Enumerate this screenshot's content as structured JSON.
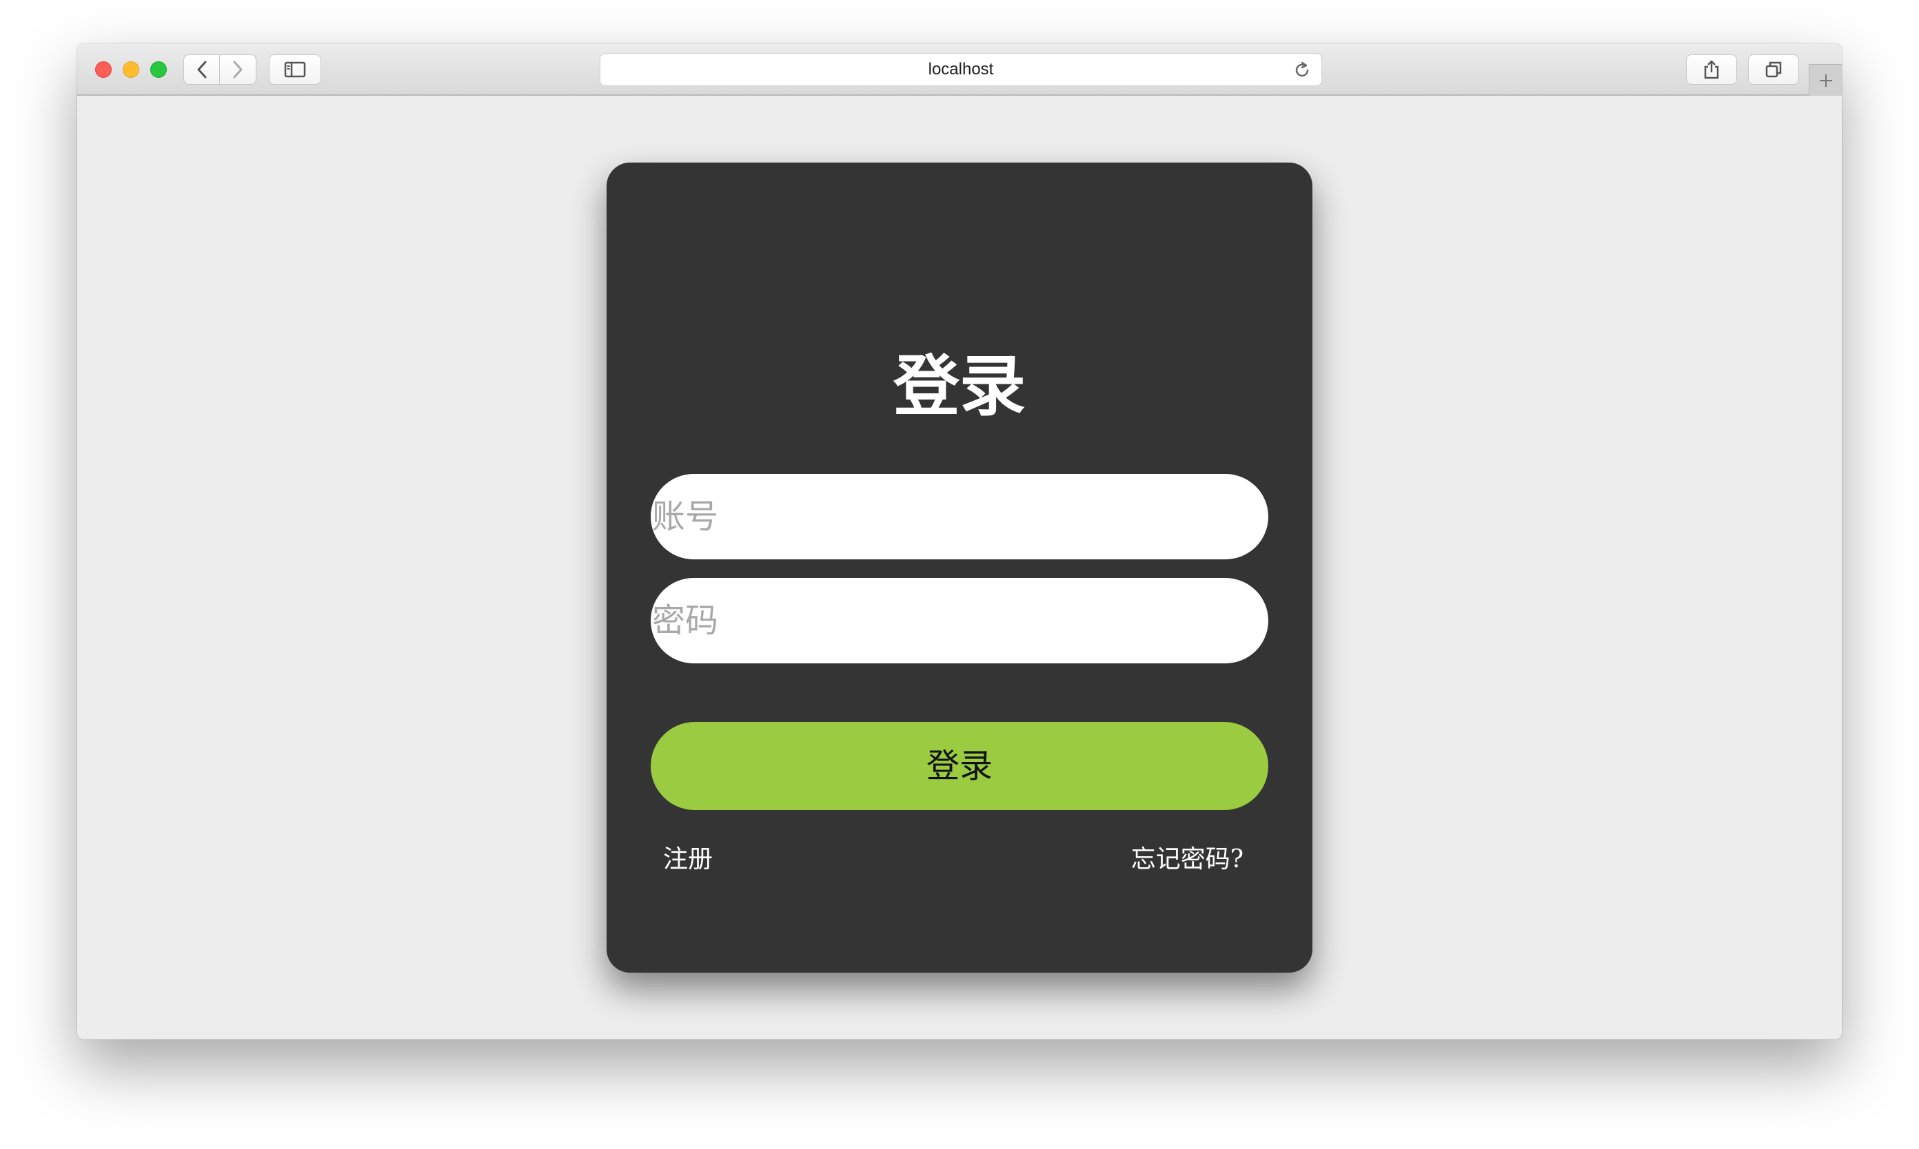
{
  "browser": {
    "address": "localhost",
    "icons": {
      "back": "chevron-left-icon",
      "forward": "chevron-right-icon",
      "sidebar": "sidebar-icon",
      "reload": "reload-icon",
      "share": "share-icon",
      "tabs": "tabs-overview-icon",
      "new_tab": "plus-icon"
    }
  },
  "login": {
    "title": "登录",
    "account_placeholder": "账号",
    "password_placeholder": "密码",
    "submit_label": "登录",
    "register_link": "注册",
    "forgot_link": "忘记密码?"
  },
  "colors": {
    "page_background": "#ededed",
    "card_background": "#343434",
    "button_accent": "#9acb40",
    "text_light": "#ffffff"
  }
}
